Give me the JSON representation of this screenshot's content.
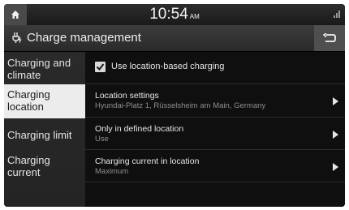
{
  "status": {
    "time": "10:54",
    "ampm": "AM"
  },
  "header": {
    "title": "Charge management"
  },
  "sidebar": {
    "items": [
      {
        "label": "Charging and climate",
        "active": false
      },
      {
        "label": "Charging location",
        "active": true
      },
      {
        "label": "Charging limit",
        "active": false
      },
      {
        "label": "Charging current",
        "active": false
      }
    ]
  },
  "settings": {
    "use_location_charging": {
      "label": "Use location-based charging",
      "checked": true
    },
    "location_settings": {
      "title": "Location settings",
      "value": "Hyundai-Platz 1, Rüsselsheim am Main, Germany"
    },
    "defined_location": {
      "title": "Only in defined location",
      "value": "Use"
    },
    "charging_current": {
      "title": "Charging current in location",
      "value": "Maximum"
    }
  }
}
